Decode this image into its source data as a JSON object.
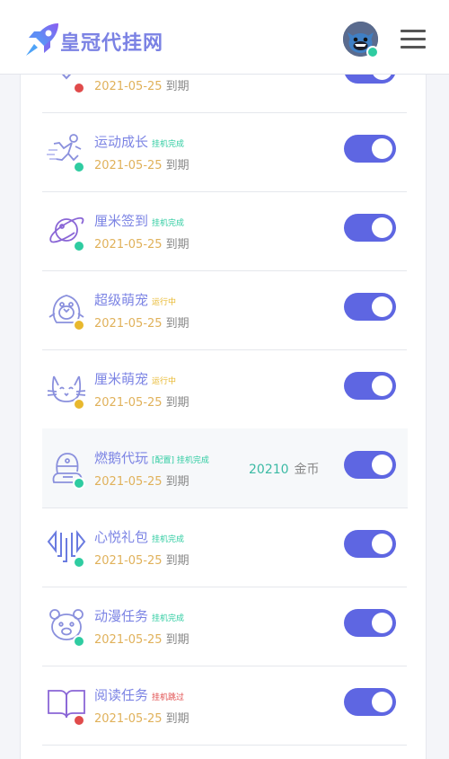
{
  "app": {
    "title": "皇冠代挂网"
  },
  "colors": {
    "accent": "#5e66e2",
    "done": "#2fcca1",
    "running": "#e8b82e",
    "skipped": "#e04b4b"
  },
  "expire_suffix": "到期",
  "coins_unit": "金币",
  "rows": [
    {
      "name": "",
      "badge": "",
      "badge_color": "",
      "date": "2021-05-25",
      "status": "skipped",
      "icon": "heart-icon"
    },
    {
      "name": "运动成长",
      "badge": "挂机完成",
      "badge_color": "#2fcca1",
      "date": "2021-05-25",
      "status": "done",
      "icon": "runner-icon"
    },
    {
      "name": "厘米签到",
      "badge": "挂机完成",
      "badge_color": "#2fcca1",
      "date": "2021-05-25",
      "status": "done",
      "icon": "planet-icon"
    },
    {
      "name": "超级萌宠",
      "badge": "运行中",
      "badge_color": "#e8b82e",
      "date": "2021-05-25",
      "status": "running",
      "icon": "penguin-icon"
    },
    {
      "name": "厘米萌宠",
      "badge": "运行中",
      "badge_color": "#e8b82e",
      "date": "2021-05-25",
      "status": "running",
      "icon": "cat-icon"
    },
    {
      "name": "燃鹅代玩",
      "badge": "[配置] 挂机完成",
      "badge_color": "#2fcca1",
      "date": "2021-05-25",
      "status": "done",
      "icon": "goose-icon",
      "coins": "20210",
      "highlight": true
    },
    {
      "name": "心悦礼包",
      "badge": "挂机完成",
      "badge_color": "#2fcca1",
      "date": "2021-05-25",
      "status": "done",
      "icon": "arrows-icon"
    },
    {
      "name": "动漫任务",
      "badge": "挂机完成",
      "badge_color": "#2fcca1",
      "date": "2021-05-25",
      "status": "done",
      "icon": "bear-icon"
    },
    {
      "name": "阅读任务",
      "badge": "挂机跳过",
      "badge_color": "#e04b4b",
      "date": "2021-05-25",
      "status": "skipped",
      "icon": "book-icon"
    }
  ]
}
